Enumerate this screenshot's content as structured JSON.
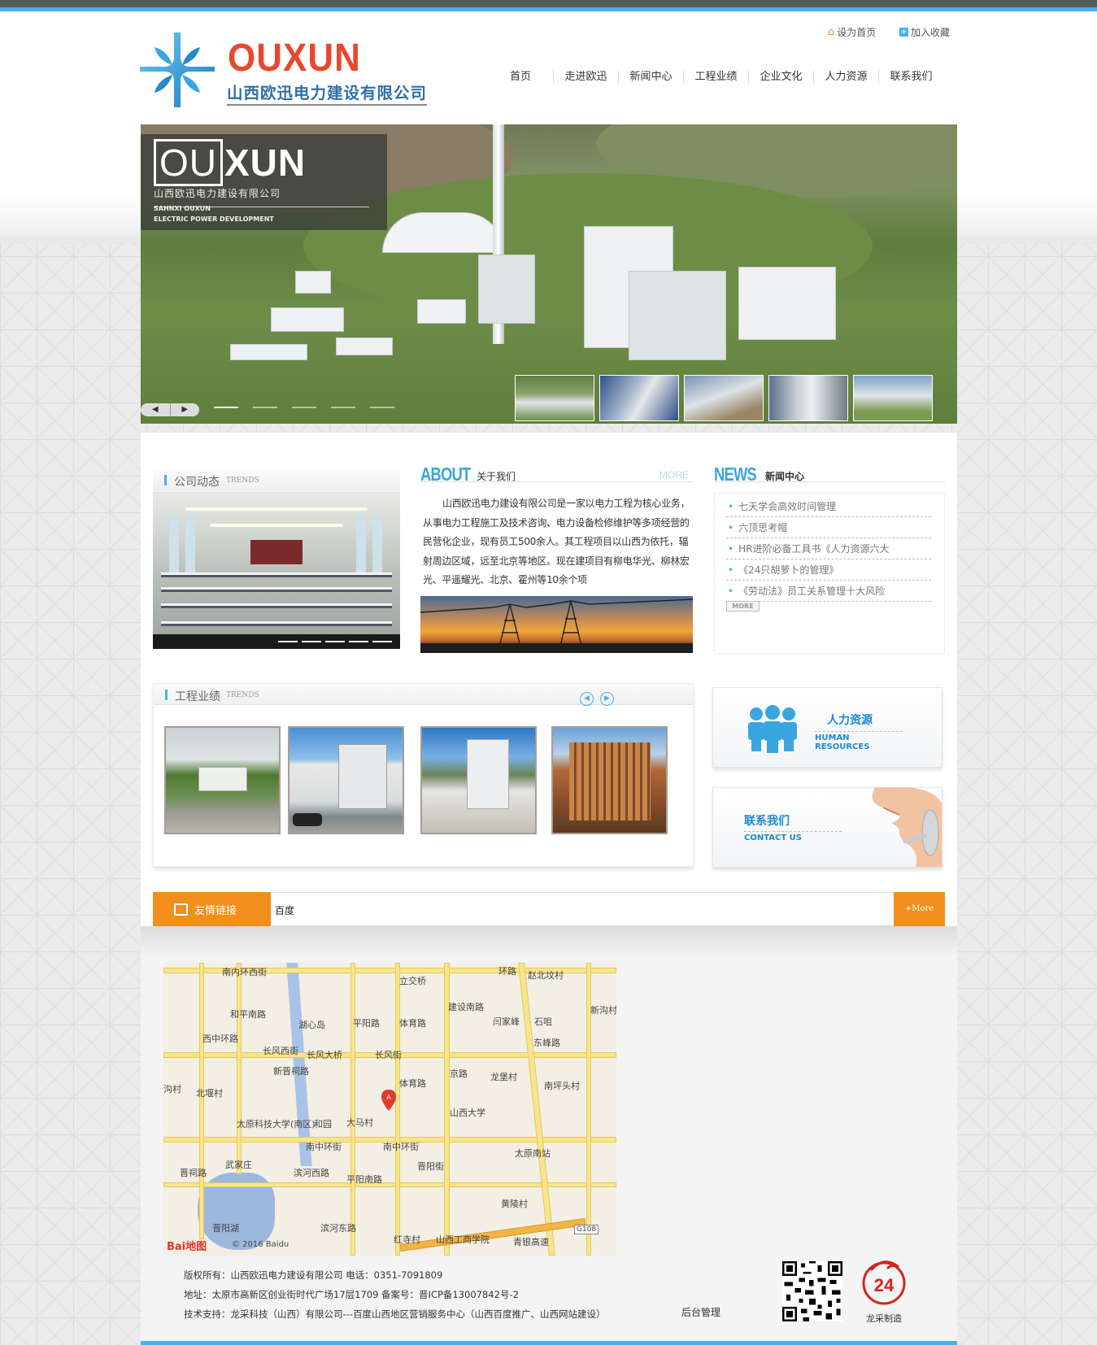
{
  "header": {
    "brand": "OUXUN",
    "brand_cn": "山西欧迅电力建设有限公司",
    "util": [
      {
        "label": "设为首页",
        "icon": "home-icon"
      },
      {
        "label": "加入收藏",
        "icon": "plus-icon"
      }
    ],
    "nav": [
      "首页",
      "走进欧迅",
      "新闻中心",
      "工程业绩",
      "企业文化",
      "人力资源",
      "联系我们"
    ]
  },
  "banner": {
    "brand_left": "OU",
    "brand_right": "XUN",
    "company": "山西欧迅电力建设有限公司",
    "en_line1": "SAHNXI OUXUN",
    "en_line2": "ELECTRIC POWER DEVELOPMENT",
    "prev": "◀",
    "next": "▶"
  },
  "dynamics": {
    "title": "公司动态",
    "title_en": "TRENDS"
  },
  "about": {
    "title_en": "ABOUT",
    "title_cn": "关于我们",
    "more": "MORE",
    "text": "山西欧迅电力建设有限公司是一家以电力工程为核心业务，从事电力工程施工及技术咨询、电力设备检修维护等多项经营的民营化企业，现有员工500余人。其工程项目以山西为依托，辐射周边区域，远至北京等地区。现在建项目有柳电华光、柳林宏光、平遥耀光、北京、霍州等10余个项"
  },
  "news": {
    "title_en": "NEWS",
    "title_cn": "新闻中心",
    "bullet": "•",
    "items": [
      "七天学会高效时间管理",
      "六顶思考帽",
      "HR进阶必备工具书《人力资源六大",
      "《24只胡萝卜的管理》",
      "《劳动法》员工关系管理十大风险"
    ],
    "more": "MORE"
  },
  "projects": {
    "title": "工程业绩",
    "title_en": "TRENDS",
    "prev": "◀",
    "next": "▶"
  },
  "hr": {
    "title_cn": "人力资源",
    "title_en": "HUMAN RESOURCES"
  },
  "contact": {
    "title_cn": "联系我们",
    "title_en": "CONTACT US"
  },
  "links": {
    "label": "友情链接",
    "value": "百度",
    "more": "+More"
  },
  "map": {
    "labels": [
      "南内环西街",
      "立交桥",
      "环路",
      "赵北坟村",
      "新沟村",
      "闫家峰",
      "石咀",
      "湖心岛",
      "平阳路",
      "体育路",
      "建设南路",
      "和平南路",
      "长风西街",
      "长风大桥",
      "长风街",
      "东峰路",
      "西中环路",
      "新晋祠路",
      "京路",
      "龙堡村",
      "南坪头村",
      "沟村",
      "北堰村",
      "体育路",
      "山西大学",
      "太原科技大学(南区)",
      "和园",
      "大马村",
      "南中环街",
      "南中环街",
      "太原南站",
      "武家庄",
      "滨河西路",
      "平阳南路",
      "晋阳街",
      "晋祠路",
      "黄陵村",
      "晋阳湖",
      "红寺村",
      "山西工商学院",
      "青银高速",
      "G108",
      "滨河东路"
    ],
    "logo": "Bai地图",
    "copyright": "© 2016 Baidu"
  },
  "footer": {
    "line1": "版权所有：山西欧迅电力建设有限公司 电话：0351-7091809",
    "line2": "地址：太原市高新区创业街时代广场17层1709 备案号：晋ICP备13007842号-2",
    "line3": "技术支持：龙采科技（山西）有限公司---百度山西地区营销服务中心（山西百度推广、山西网站建设）",
    "admin": "后台管理",
    "longcai": "龙采制造",
    "longcai_num": "24"
  },
  "colors": {
    "accent": "#4bb0e8",
    "brand_red": "#e8482e",
    "orange": "#f28e1b",
    "nav_text": "#333333"
  }
}
